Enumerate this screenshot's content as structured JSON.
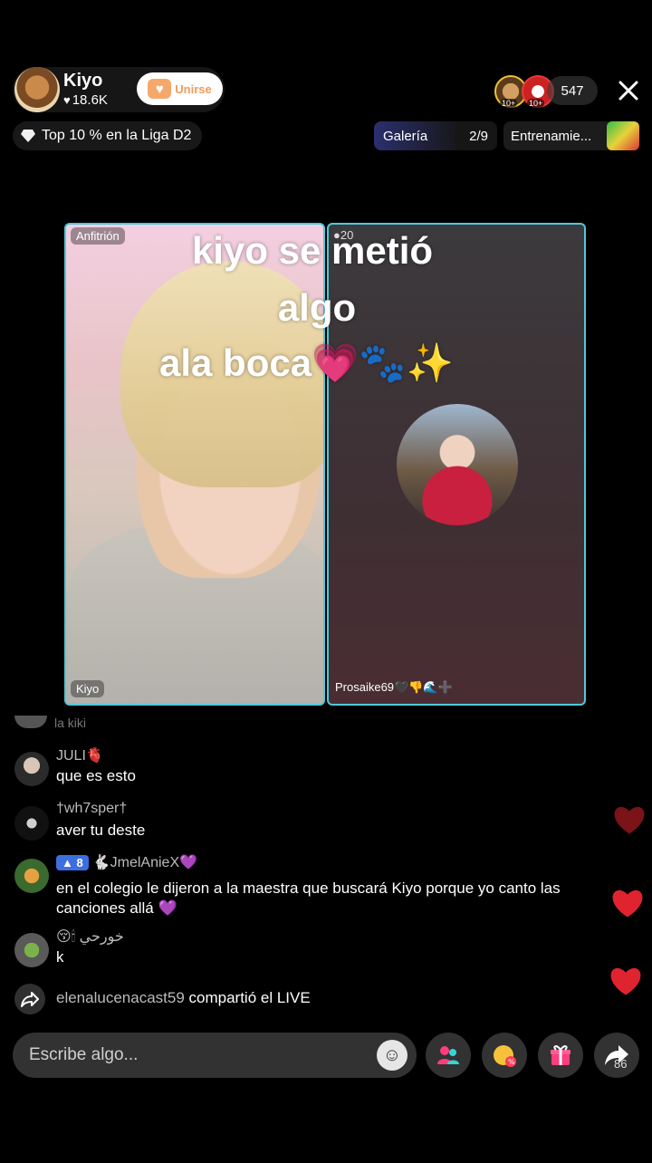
{
  "host": {
    "name": "Kiyo",
    "likes": "18.6K",
    "join_label": "Unirse"
  },
  "viewers": {
    "count": "547",
    "avatar_badges": [
      "10+",
      "10+"
    ]
  },
  "league": {
    "label": "Top 10 % en la Liga D2"
  },
  "gallery": {
    "label": "Galería",
    "progress": "2/9"
  },
  "training": {
    "label": "Entrenamie..."
  },
  "panels": {
    "left_tag": "Anfitrión",
    "left_name": "Kiyo",
    "right_score": "20",
    "right_name": "Prosaike69🖤👎🌊➕"
  },
  "caption": {
    "line1": "kiyo se metió",
    "line2": "algo",
    "line3": "ala boca💗🐾✨"
  },
  "chat": {
    "faded_text": "la kiki",
    "messages": [
      {
        "user": "JULI🫀",
        "text": "que es esto",
        "level": ""
      },
      {
        "user": "†wh7sper†",
        "text": "aver tu deste",
        "level": ""
      },
      {
        "user": "🐇JmelAnieX💜",
        "text": "en el colegio le dijeron a la maestra que buscará Kiyo porque yo canto las canciones allá 💜",
        "level": "8"
      },
      {
        "user": "😚🕯 خورحي",
        "text": "k",
        "level": ""
      }
    ],
    "share": {
      "user": "elenalucenacast59",
      "action": "compartió el LIVE"
    }
  },
  "bottom_bar": {
    "input_placeholder": "Escribe algo...",
    "share_count": "86"
  },
  "colors": {
    "panel_border": "#52c7d8",
    "join_text": "#f09a5a",
    "heart": "#e0242f"
  }
}
